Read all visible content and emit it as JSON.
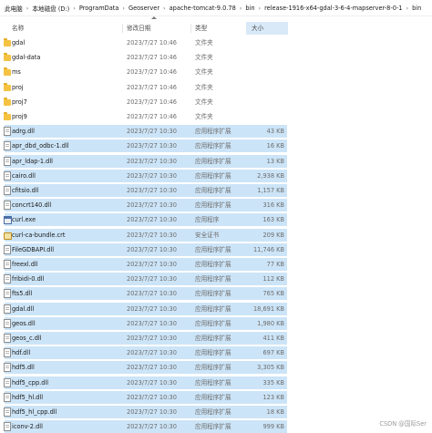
{
  "breadcrumb": {
    "items": [
      "此电脑",
      "本地磁盘 (D:)",
      "ProgramData",
      "Geoserver",
      "apache-tomcat-9.0.78",
      "bin",
      "release-1916-x64-gdal-3-6-4-mapserver-8-0-1",
      "bin"
    ]
  },
  "columns": {
    "name": "名称",
    "date": "修改日期",
    "type": "类型",
    "size": "大小"
  },
  "files": [
    {
      "name": "gdal",
      "date": "2023/7/27 10:46",
      "type": "文件夹",
      "size": "",
      "icon": "folder-icon",
      "selected": false
    },
    {
      "name": "gdal-data",
      "date": "2023/7/27 10:46",
      "type": "文件夹",
      "size": "",
      "icon": "folder-icon",
      "selected": false
    },
    {
      "name": "ms",
      "date": "2023/7/27 10:46",
      "type": "文件夹",
      "size": "",
      "icon": "folder-icon",
      "selected": false
    },
    {
      "name": "proj",
      "date": "2023/7/27 10:46",
      "type": "文件夹",
      "size": "",
      "icon": "folder-icon",
      "selected": false
    },
    {
      "name": "proj7",
      "date": "2023/7/27 10:46",
      "type": "文件夹",
      "size": "",
      "icon": "folder-icon",
      "selected": false
    },
    {
      "name": "proj9",
      "date": "2023/7/27 10:46",
      "type": "文件夹",
      "size": "",
      "icon": "folder-icon",
      "selected": false
    },
    {
      "name": "adrg.dll",
      "date": "2023/7/27 10:30",
      "type": "应用程序扩展",
      "size": "43 KB",
      "icon": "dll-file-icon",
      "selected": true
    },
    {
      "name": "apr_dbd_odbc-1.dll",
      "date": "2023/7/27 10:30",
      "type": "应用程序扩展",
      "size": "16 KB",
      "icon": "dll-file-icon",
      "selected": true
    },
    {
      "name": "apr_ldap-1.dll",
      "date": "2023/7/27 10:30",
      "type": "应用程序扩展",
      "size": "13 KB",
      "icon": "dll-file-icon",
      "selected": true
    },
    {
      "name": "cairo.dll",
      "date": "2023/7/27 10:30",
      "type": "应用程序扩展",
      "size": "2,938 KB",
      "icon": "dll-file-icon",
      "selected": true
    },
    {
      "name": "cfitsio.dll",
      "date": "2023/7/27 10:30",
      "type": "应用程序扩展",
      "size": "1,157 KB",
      "icon": "dll-file-icon",
      "selected": true
    },
    {
      "name": "concrt140.dll",
      "date": "2023/7/27 10:30",
      "type": "应用程序扩展",
      "size": "316 KB",
      "icon": "dll-file-icon",
      "selected": true
    },
    {
      "name": "curl.exe",
      "date": "2023/7/27 10:30",
      "type": "应用程序",
      "size": "163 KB",
      "icon": "exe-file-icon",
      "selected": true
    },
    {
      "name": "curl-ca-bundle.crt",
      "date": "2023/7/27 10:30",
      "type": "安全证书",
      "size": "209 KB",
      "icon": "certificate-icon",
      "selected": true
    },
    {
      "name": "FileGDBAPI.dll",
      "date": "2023/7/27 10:30",
      "type": "应用程序扩展",
      "size": "11,746 KB",
      "icon": "dll-file-icon",
      "selected": true
    },
    {
      "name": "freexl.dll",
      "date": "2023/7/27 10:30",
      "type": "应用程序扩展",
      "size": "77 KB",
      "icon": "dll-file-icon",
      "selected": true
    },
    {
      "name": "fribidi-0.dll",
      "date": "2023/7/27 10:30",
      "type": "应用程序扩展",
      "size": "112 KB",
      "icon": "dll-file-icon",
      "selected": true
    },
    {
      "name": "fts5.dll",
      "date": "2023/7/27 10:30",
      "type": "应用程序扩展",
      "size": "765 KB",
      "icon": "dll-file-icon",
      "selected": true
    },
    {
      "name": "gdal.dll",
      "date": "2023/7/27 10:30",
      "type": "应用程序扩展",
      "size": "18,691 KB",
      "icon": "dll-file-icon",
      "selected": true
    },
    {
      "name": "geos.dll",
      "date": "2023/7/27 10:30",
      "type": "应用程序扩展",
      "size": "1,980 KB",
      "icon": "dll-file-icon",
      "selected": true
    },
    {
      "name": "geos_c.dll",
      "date": "2023/7/27 10:30",
      "type": "应用程序扩展",
      "size": "411 KB",
      "icon": "dll-file-icon",
      "selected": true
    },
    {
      "name": "hdf.dll",
      "date": "2023/7/27 10:30",
      "type": "应用程序扩展",
      "size": "697 KB",
      "icon": "dll-file-icon",
      "selected": true
    },
    {
      "name": "hdf5.dll",
      "date": "2023/7/27 10:30",
      "type": "应用程序扩展",
      "size": "3,305 KB",
      "icon": "dll-file-icon",
      "selected": true
    },
    {
      "name": "hdf5_cpp.dll",
      "date": "2023/7/27 10:30",
      "type": "应用程序扩展",
      "size": "335 KB",
      "icon": "dll-file-icon",
      "selected": true
    },
    {
      "name": "hdf5_hl.dll",
      "date": "2023/7/27 10:30",
      "type": "应用程序扩展",
      "size": "123 KB",
      "icon": "dll-file-icon",
      "selected": true
    },
    {
      "name": "hdf5_hl_cpp.dll",
      "date": "2023/7/27 10:30",
      "type": "应用程序扩展",
      "size": "18 KB",
      "icon": "dll-file-icon",
      "selected": true
    },
    {
      "name": "iconv-2.dll",
      "date": "2023/7/27 10:30",
      "type": "应用程序扩展",
      "size": "999 KB",
      "icon": "dll-file-icon",
      "selected": true
    }
  ],
  "watermark": "CSDN @国际Ser",
  "colors": {
    "selection": "#cce4f7",
    "sorted_header": "#d9e9f8",
    "folder": "#f5c342"
  }
}
